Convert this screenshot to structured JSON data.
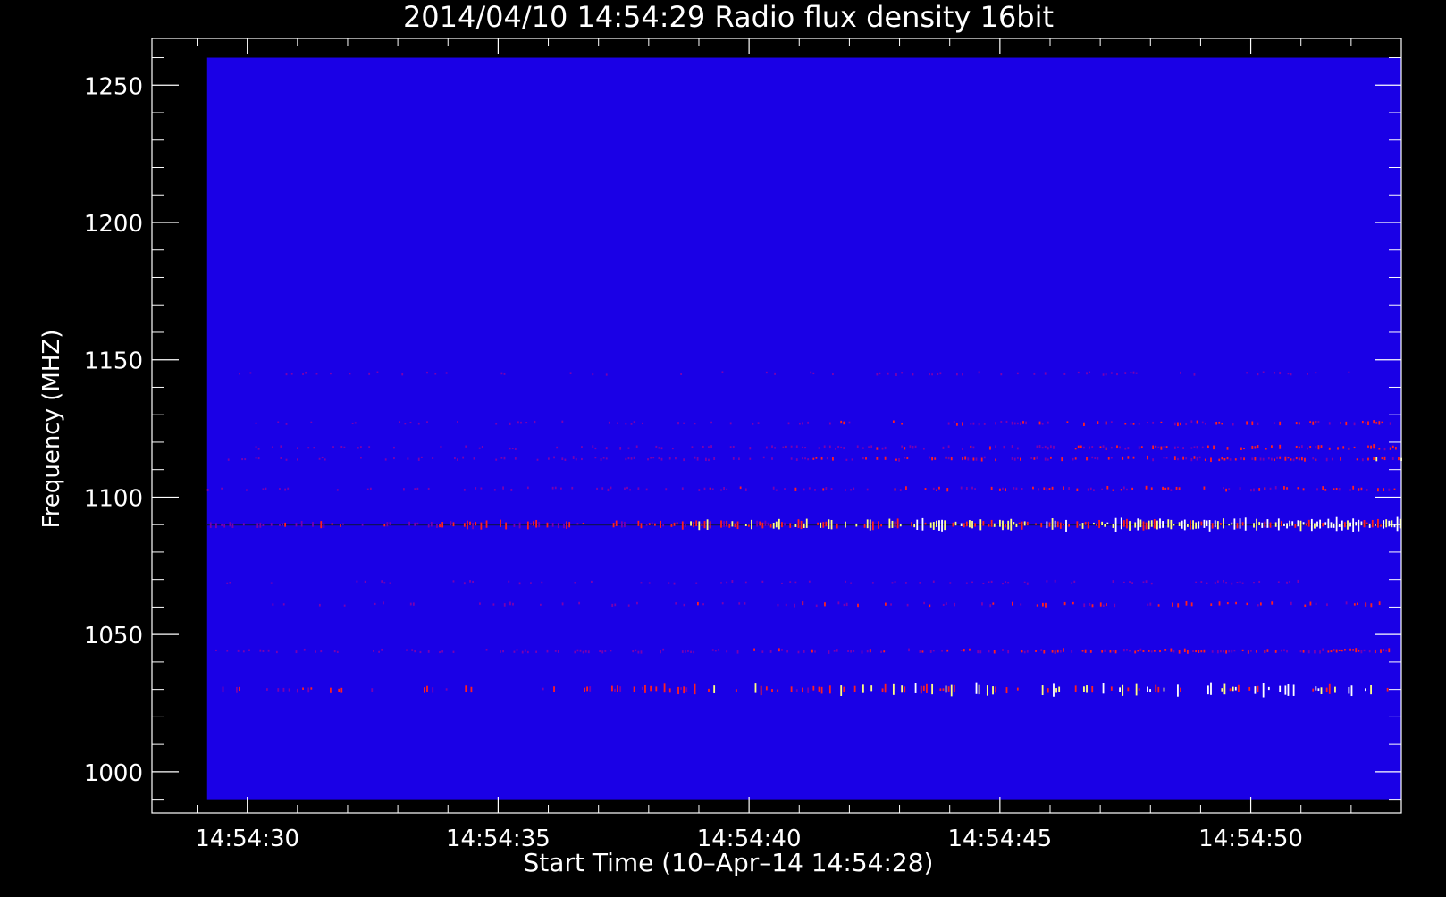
{
  "chart_data": {
    "type": "heatmap",
    "title": "2014/04/10 14:54:29 Radio flux density 16bit",
    "xlabel": "Start Time (10–Apr–14 14:54:28)",
    "ylabel": "Frequency (MHZ)",
    "x_axis": {
      "range": [
        "14:54:28.1",
        "14:54:53.0"
      ],
      "ticks": [
        "14:54:30",
        "14:54:35",
        "14:54:40",
        "14:54:45",
        "14:54:50"
      ]
    },
    "y_axis": {
      "range": [
        985,
        1267
      ],
      "ticks": [
        1000,
        1050,
        1100,
        1150,
        1200,
        1250
      ]
    },
    "data_extent": {
      "x": [
        "14:54:29.2",
        "14:54:53.0"
      ],
      "y": [
        990,
        1260
      ]
    },
    "grid": false,
    "colormap": {
      "background": "#1a00e6",
      "low": "#7a00b0",
      "mid": "#ff2020",
      "high": "#ffff80",
      "peak": "#ffffff"
    },
    "emission_bands": [
      {
        "freq_mhz": 1090,
        "start": "14:54:29.2",
        "end": "14:54:53.0",
        "intensity_start": 0.3,
        "intensity_end": 1.0,
        "density": 1.0
      },
      {
        "freq_mhz": 1030,
        "start": "14:54:29.5",
        "end": "14:54:52.8",
        "intensity_start": 0.3,
        "intensity_end": 0.95,
        "density": 0.45
      },
      {
        "freq_mhz": 1044,
        "start": "14:54:29.2",
        "end": "14:54:53.0",
        "intensity_start": 0.15,
        "intensity_end": 0.5,
        "density": 0.6
      },
      {
        "freq_mhz": 1061,
        "start": "14:54:30.0",
        "end": "14:54:52.8",
        "intensity_start": 0.2,
        "intensity_end": 0.55,
        "density": 0.35
      },
      {
        "freq_mhz": 1069,
        "start": "14:54:29.2",
        "end": "14:54:51.0",
        "intensity_start": 0.15,
        "intensity_end": 0.2,
        "density": 0.25
      },
      {
        "freq_mhz": 1103,
        "start": "14:54:29.2",
        "end": "14:54:53.0",
        "intensity_start": 0.2,
        "intensity_end": 0.5,
        "density": 0.45
      },
      {
        "freq_mhz": 1114,
        "start": "14:54:29.5",
        "end": "14:54:53.0",
        "intensity_start": 0.15,
        "intensity_end": 0.55,
        "density": 0.6
      },
      {
        "freq_mhz": 1118,
        "start": "14:54:29.5",
        "end": "14:54:53.0",
        "intensity_start": 0.15,
        "intensity_end": 0.5,
        "density": 0.5
      },
      {
        "freq_mhz": 1127,
        "start": "14:54:29.5",
        "end": "14:54:52.8",
        "intensity_start": 0.15,
        "intensity_end": 0.5,
        "density": 0.4
      },
      {
        "freq_mhz": 1145,
        "start": "14:54:29.5",
        "end": "14:54:52.0",
        "intensity_start": 0.15,
        "intensity_end": 0.2,
        "density": 0.25
      }
    ]
  }
}
